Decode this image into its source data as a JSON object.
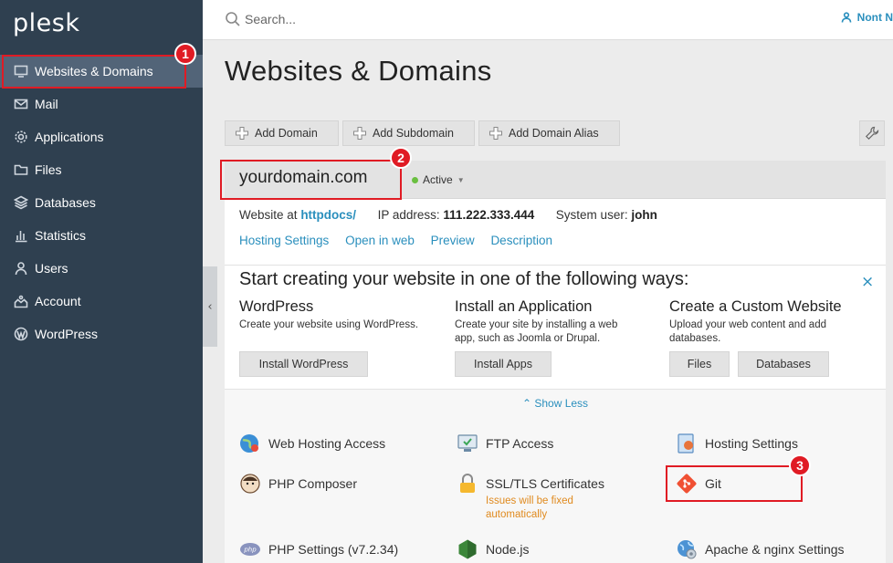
{
  "brand": {
    "logo": "plesk"
  },
  "sidebar": {
    "items": [
      {
        "label": "Websites & Domains",
        "icon": "monitor-icon"
      },
      {
        "label": "Mail",
        "icon": "mail-icon"
      },
      {
        "label": "Applications",
        "icon": "gear-icon"
      },
      {
        "label": "Files",
        "icon": "folder-icon"
      },
      {
        "label": "Databases",
        "icon": "database-icon"
      },
      {
        "label": "Statistics",
        "icon": "bar-chart-icon"
      },
      {
        "label": "Users",
        "icon": "user-icon"
      },
      {
        "label": "Account",
        "icon": "account-icon"
      },
      {
        "label": "WordPress",
        "icon": "wordpress-icon"
      }
    ],
    "collapse_glyph": "‹"
  },
  "header": {
    "search_placeholder": "Search...",
    "user_name": "Nont N"
  },
  "page": {
    "title": "Websites & Domains"
  },
  "toolbar": {
    "add_domain": "Add Domain",
    "add_subdomain": "Add Subdomain",
    "add_domain_alias": "Add Domain Alias"
  },
  "domain": {
    "name": "yourdomain.com",
    "status": "Active",
    "website_at_label": "Website at",
    "website_at_value": "httpdocs/",
    "ip_label": "IP address:",
    "ip_value": "111.222.333.444",
    "user_label": "System user:",
    "user_value": "john",
    "links": [
      "Hosting Settings",
      "Open in web",
      "Preview",
      "Description"
    ]
  },
  "start": {
    "title": "Start creating your website in one of the following ways:",
    "close": "×",
    "wordpress": {
      "title": "WordPress",
      "desc": "Create your website using WordPress.",
      "button": "Install WordPress"
    },
    "application": {
      "title": "Install an Application",
      "desc": "Create your site by installing a web app, such as Joomla or Drupal.",
      "button": "Install Apps"
    },
    "custom": {
      "title": "Create a Custom Website",
      "desc": "Upload your web content and add databases.",
      "files_button": "Files",
      "databases_button": "Databases"
    }
  },
  "tools": {
    "show_less": "Show Less",
    "items": {
      "web_hosting_access": "Web Hosting Access",
      "ftp_access": "FTP Access",
      "hosting_settings": "Hosting Settings",
      "php_composer": "PHP Composer",
      "ssl_tls": "SSL/TLS Certificates",
      "ssl_warning": "Issues will be fixed automatically",
      "git": "Git",
      "php_settings": "PHP Settings (v7.2.34)",
      "nodejs": "Node.js",
      "apache_nginx": "Apache & nginx Settings"
    }
  },
  "annotations": {
    "one": "1",
    "two": "2",
    "three": "3"
  },
  "colors": {
    "sidebar": "#2f4050",
    "link": "#2a8fbd",
    "active_dot": "#6abf40",
    "annotation": "#e01b24",
    "warning": "#e08a1e"
  }
}
